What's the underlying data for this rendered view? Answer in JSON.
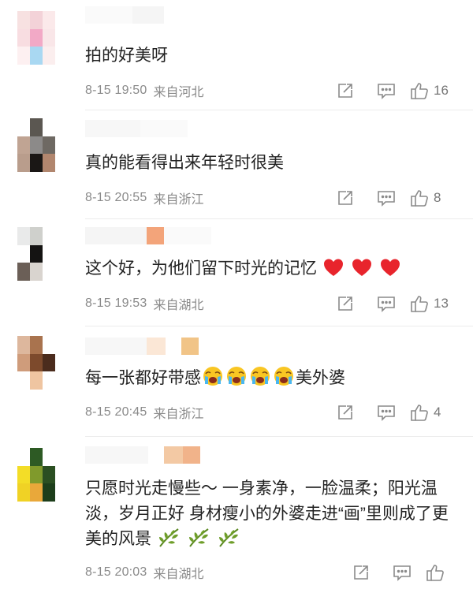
{
  "comments": [
    {
      "text": "拍的好美呀",
      "time": "8-15 19:50",
      "location": "来自河北",
      "likes": "16",
      "avatar_colors": [
        "#f7e1e1",
        "#f3d2d8",
        "#fbe9ea",
        "#f8dde1",
        "#f2a9c6",
        "#f9e6e8",
        "#fdf0f1",
        "#a9d8f2",
        "#fbeeee"
      ]
    },
    {
      "text": "真的能看得出来年轻时很美",
      "time": "8-15 20:55",
      "location": "来自浙江",
      "likes": "8",
      "avatar_colors": [
        "#ffffff",
        "#5b5751",
        "#ffffff",
        "#c0a493",
        "#8c8a89",
        "#6e6963",
        "#b99d8c",
        "#1a1715",
        "#b1866e"
      ]
    },
    {
      "text": "这个好，为他们留下时光的记忆",
      "time": "8-15 19:53",
      "location": "来自湖北",
      "likes": "13",
      "avatar_colors": [
        "#e9eaea",
        "#cfd0cc",
        "#ffffff",
        "#ffffff",
        "#141312",
        "#ffffff",
        "#6b5f57",
        "#d9d4cf",
        "#ffffff"
      ]
    },
    {
      "text": "每一张都好带感",
      "text_suffix": "美外婆",
      "time": "8-15 20:45",
      "location": "来自浙江",
      "likes": "4",
      "avatar_colors": [
        "#ddb79d",
        "#a9734e",
        "#ffffff",
        "#cf9c7b",
        "#7d4a2c",
        "#4b2c1d",
        "#ffffff",
        "#efc5a1",
        "#ffffff"
      ]
    },
    {
      "text": "只愿时光走慢些～ 一身素净，一脸温柔；阳光温淡，岁月正好 身材瘦小的外婆走进“画”里则成了更美的风景",
      "time": "8-15 20:03",
      "location": "来自湖北",
      "likes": "",
      "avatar_colors": [
        "#ffffff",
        "#2d5a24",
        "#ffffff",
        "#f3dd27",
        "#809a2c",
        "#2b4f22",
        "#f0d225",
        "#e9a83a",
        "#1d3e1b"
      ]
    }
  ],
  "icons": {
    "repost": "share-box-icon",
    "comment": "comment-bubble-icon",
    "like": "thumbs-up-icon",
    "emoji_face": "crying-face-emoji",
    "emoji_heart": "red-heart-emoji",
    "emoji_leaf": "leaf-emoji"
  },
  "colors": {
    "meta": "#8a8a8a",
    "heart": "#e8242c",
    "leaf": "#5c8a22"
  }
}
